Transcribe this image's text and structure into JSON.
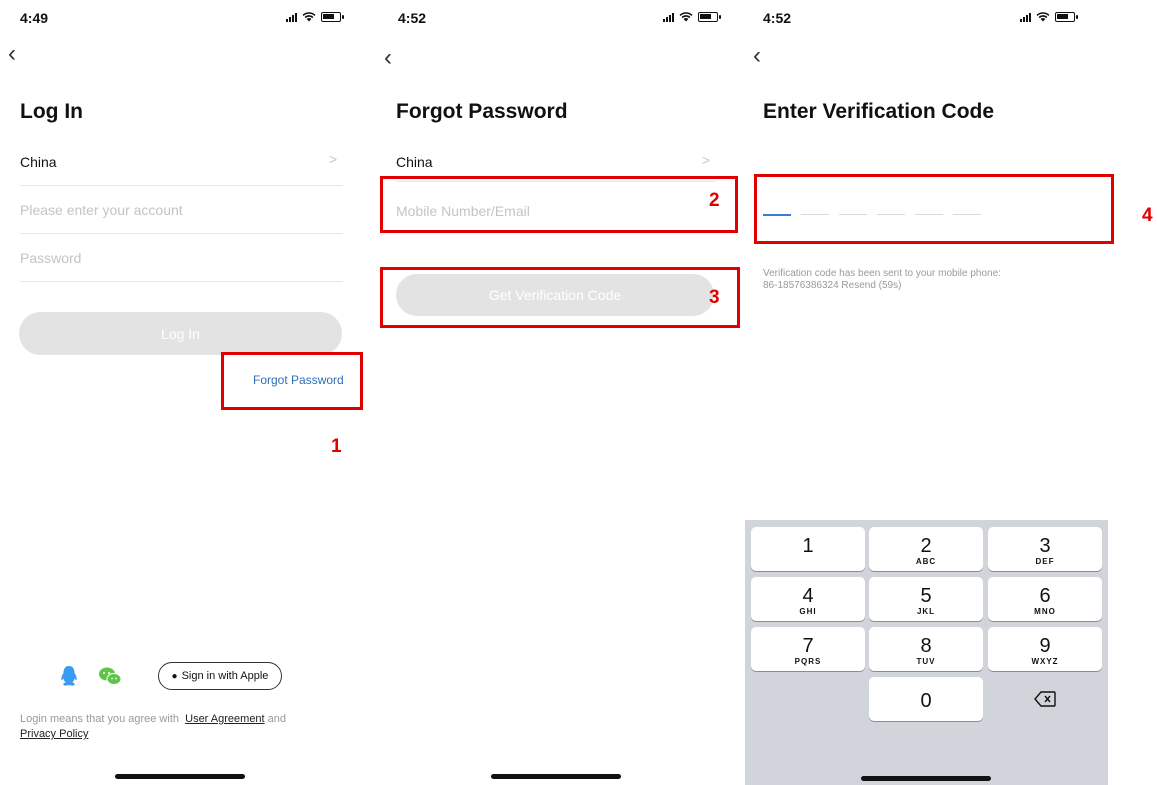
{
  "screen1": {
    "status_time": "4:49",
    "title": "Log In",
    "country": "China",
    "account_placeholder": "Please enter your account",
    "password_placeholder": "Password",
    "login_button": "Log In",
    "forgot_link": "Forgot Password",
    "step_number": "1",
    "apple_button": "Sign in with Apple",
    "legal_prefix": "Login means that you agree with",
    "user_agreement": "User Agreement",
    "legal_and": "and",
    "privacy_policy": "Privacy Policy"
  },
  "screen2": {
    "status_time": "4:52",
    "title": "Forgot Password",
    "country": "China",
    "mobile_placeholder": "Mobile Number/Email",
    "get_code_button": "Get Verification Code",
    "step_number_field": "2",
    "step_number_button": "3"
  },
  "screen3": {
    "status_time": "4:52",
    "title": "Enter Verification Code",
    "step_number": "4",
    "sent_message": "Verification code has been sent to your mobile phone:",
    "phone_resend": "86-18576386324  Resend (59s)",
    "keys": [
      {
        "digit": "1",
        "letters": ""
      },
      {
        "digit": "2",
        "letters": "ABC"
      },
      {
        "digit": "3",
        "letters": "DEF"
      },
      {
        "digit": "4",
        "letters": "GHI"
      },
      {
        "digit": "5",
        "letters": "JKL"
      },
      {
        "digit": "6",
        "letters": "MNO"
      },
      {
        "digit": "7",
        "letters": "PQRS"
      },
      {
        "digit": "8",
        "letters": "TUV"
      },
      {
        "digit": "9",
        "letters": "WXYZ"
      },
      {
        "digit": "0",
        "letters": ""
      }
    ]
  },
  "colors": {
    "annotation_red": "#e00000",
    "link_blue": "#2f6db5",
    "disabled_button": "#e3e3e3",
    "qq_blue": "#3a9bf2",
    "wechat_green": "#5fc44a"
  }
}
